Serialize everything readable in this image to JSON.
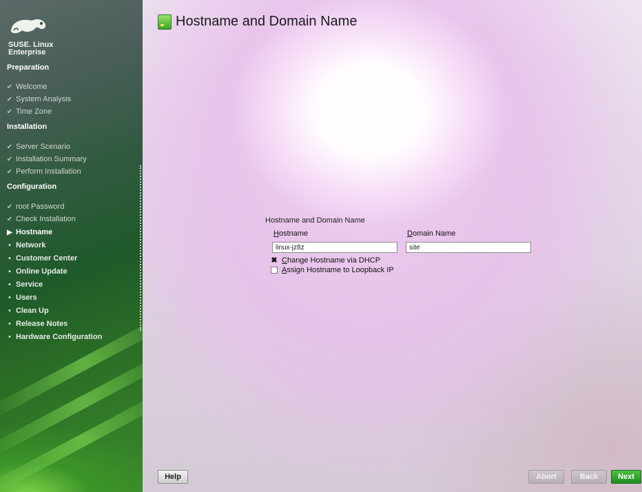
{
  "sidebar": {
    "brand_line1": "SUSE. Linux",
    "brand_line2": "Enterprise",
    "sections": {
      "preparation": "Preparation",
      "installation": "Installation",
      "configuration": "Configuration"
    },
    "steps": {
      "welcome": "Welcome",
      "system_analysis": "System Analysis",
      "time_zone": "Time Zone",
      "server_scenario": "Server Scenario",
      "installation_summary": "Installation Summary",
      "perform_installation": "Perform Installation",
      "root_password": "root Password",
      "check_installation": "Check Installation",
      "hostname": "Hostname",
      "network": "Network",
      "customer_center": "Customer Center",
      "online_update": "Online Update",
      "service": "Service",
      "users": "Users",
      "clean_up": "Clean Up",
      "release_notes": "Release Notes",
      "hardware_configuration": "Hardware Configuration"
    },
    "markers": {
      "done": "✔",
      "current": "▶",
      "pending": "•"
    }
  },
  "main": {
    "title": "Hostname and Domain Name",
    "group_label": "Hostname and Domain Name",
    "hostname": {
      "label_first": "H",
      "label_rest": "ostname",
      "value": "linux-jz8z"
    },
    "domain": {
      "label_first": "D",
      "label_rest": "omain Name",
      "value": "site"
    },
    "dhcp_checkbox": {
      "label_first": "C",
      "label_rest": "hange Hostname via DHCP",
      "checked": true,
      "mark": "✖"
    },
    "loopback_checkbox": {
      "label_first": "A",
      "label_rest": "ssign Hostname to Loopback IP",
      "checked": false
    }
  },
  "buttons": {
    "help": "Help",
    "abort": "Abort",
    "back": "Back",
    "next": "Next"
  },
  "colors": {
    "next_button": "#2aa52a",
    "sidebar_green": "#2a6e25"
  }
}
